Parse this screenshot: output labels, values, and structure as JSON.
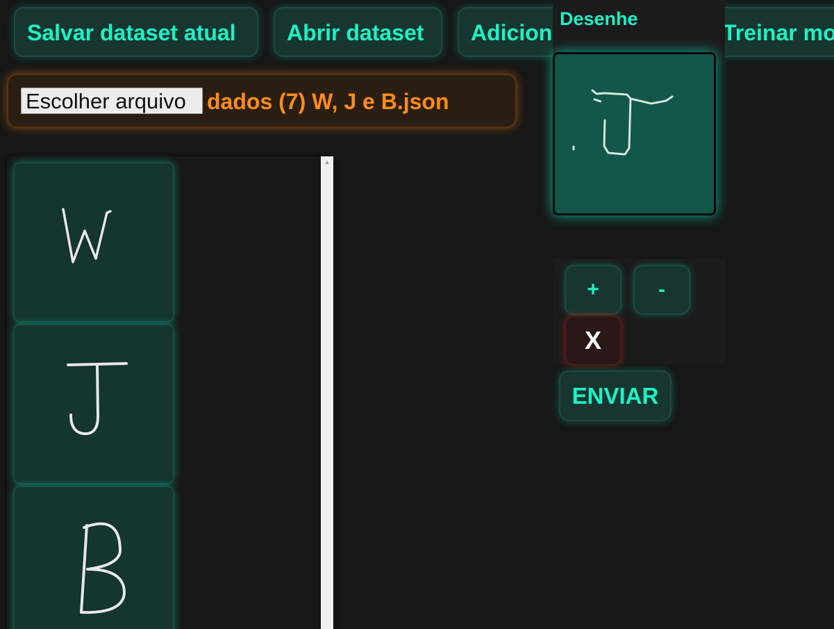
{
  "toolbar": {
    "save_label": "Salvar dataset atual",
    "open_label": "Abrir dataset",
    "add_label": "Adicionar desenho",
    "train_label": "Treinar mo"
  },
  "file_input": {
    "button_label": "Escolher arquivo",
    "file_name": "dados (7) W, J e B.json"
  },
  "samples": [
    {
      "letter": "W"
    },
    {
      "letter": "J"
    },
    {
      "letter": "B"
    }
  ],
  "draw": {
    "title": "Desenhe",
    "current_letter": "J"
  },
  "controls": {
    "plus_label": "+",
    "minus_label": "-",
    "clear_label": "X",
    "send_label": "ENVIAR"
  },
  "colors": {
    "accent": "#1ff0c4",
    "file_accent": "#ff8c1a",
    "background": "#171717",
    "card": "#15352f",
    "canvas": "#13574a"
  }
}
